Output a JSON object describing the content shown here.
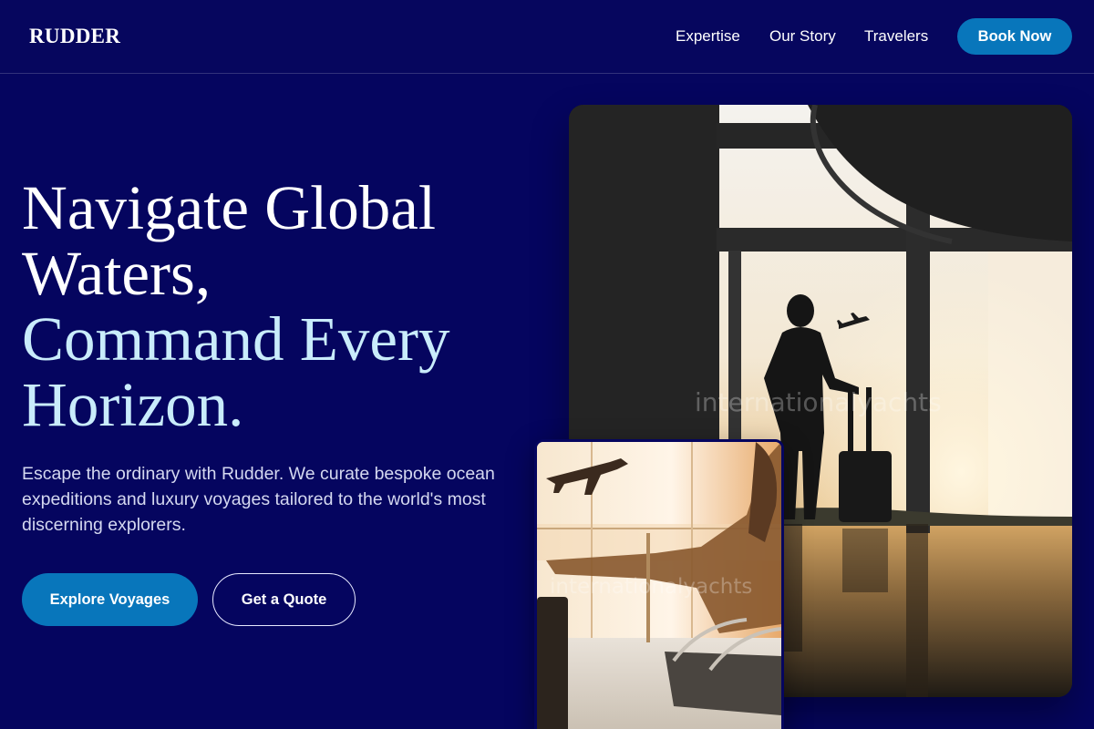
{
  "header": {
    "logo": "RUDDER",
    "nav": [
      "Expertise",
      "Our Story",
      "Travelers"
    ],
    "cta": "Book Now"
  },
  "hero": {
    "headline_line1": "Navigate Global",
    "headline_line2": "Waters,",
    "headline_line3": "Command Every",
    "headline_line4": "Horizon.",
    "subtext": "Escape the ordinary with Rudder. We curate bespoke ocean expeditions and luxury voyages tailored to the world's most discerning explorers.",
    "primary_button": "Explore Voyages",
    "secondary_button": "Get a Quote"
  },
  "images": {
    "watermark": "internationalyachts"
  },
  "colors": {
    "background": "#05055f",
    "accent": "#0876bb",
    "headline_highlight": "#c9ecfb"
  }
}
